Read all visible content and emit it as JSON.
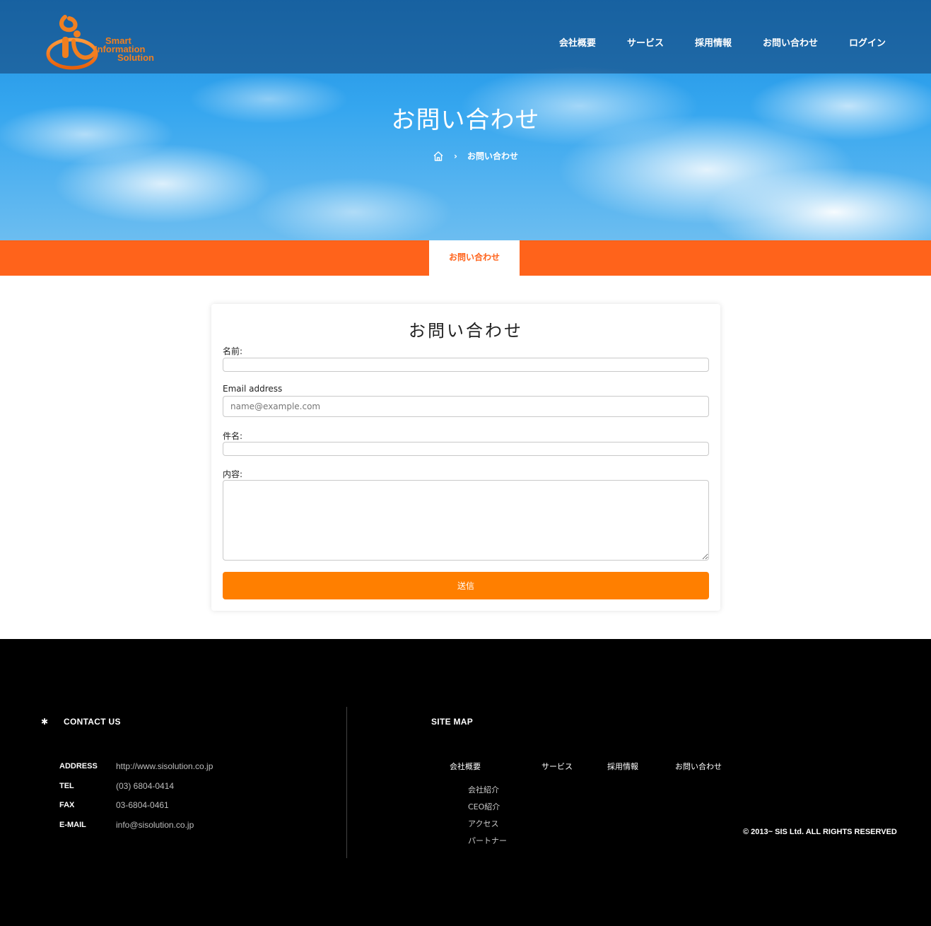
{
  "header": {
    "logo_lines": [
      "Smart",
      "Information",
      "Solution"
    ],
    "nav": [
      "会社概要",
      "サービス",
      "採用情報",
      "お問い合わせ",
      "ログイン"
    ]
  },
  "hero": {
    "title": "お問い合わせ",
    "breadcrumb_current": "お問い合わせ",
    "breadcrumb_separator": "›"
  },
  "tabbar": {
    "active_tab": "お問い合わせ"
  },
  "form": {
    "title": "お問い合わせ",
    "name_label": "名前:",
    "name_value": "",
    "email_label": "Email address",
    "email_placeholder": "name@example.com",
    "subject_label": "件名:",
    "subject_value": "",
    "message_label": "内容:",
    "message_value": "",
    "submit_label": "送信"
  },
  "footer": {
    "contact_heading": "CONTACT US",
    "contact_rows": [
      {
        "key": "ADDRESS",
        "value": "http://www.sisolution.co.jp"
      },
      {
        "key": "TEL",
        "value": "(03) 6804-0414"
      },
      {
        "key": "FAX",
        "value": "03-6804-0461"
      },
      {
        "key": "E-MAIL",
        "value": "info@sisolution.co.jp"
      }
    ],
    "sitemap_heading": "SITE MAP",
    "sitemap_top": [
      "会社概要",
      "サービス",
      "採用情報",
      "お問い合わせ"
    ],
    "sitemap_sub": [
      "会社紹介",
      "CEO紹介",
      "アクセス",
      "パートナー"
    ],
    "copyright": "© 2013~ SIS Ltd. ALL RIGHTS RESERVED"
  },
  "colors": {
    "brand_orange": "#ff631b",
    "button_orange": "#ff7f00",
    "footer_bg": "#000000"
  },
  "icons": [
    "logo-mark-icon",
    "home-icon",
    "asterisk-icon"
  ]
}
